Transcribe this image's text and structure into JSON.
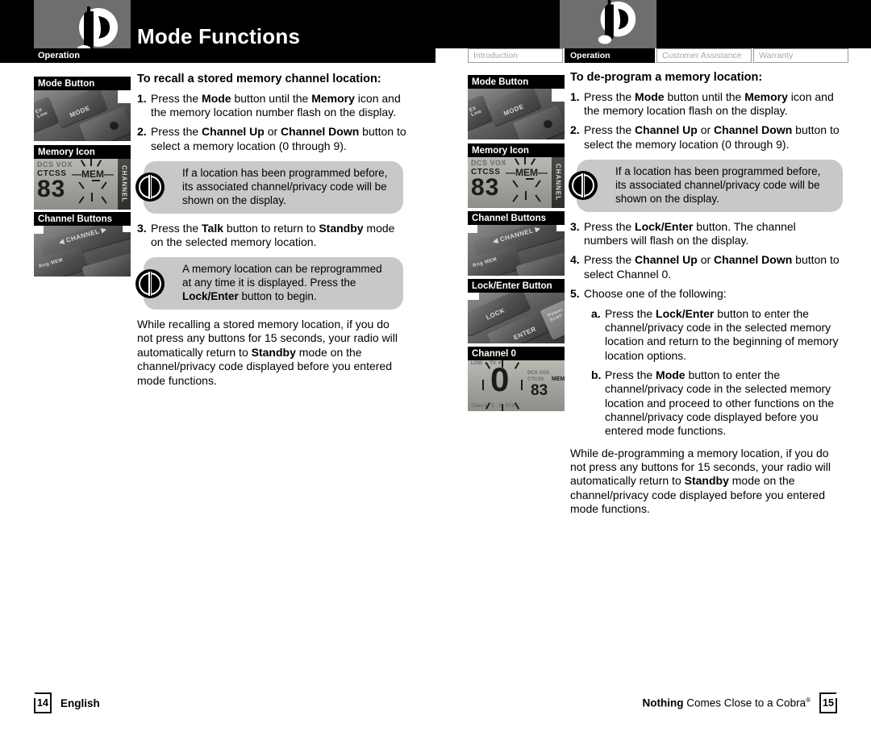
{
  "header": {
    "title": "Mode Functions",
    "logo_icon": "cobra-radio-logo-icon",
    "left_section_chip": "Operation"
  },
  "tabs": [
    {
      "label": "Introduction",
      "active": false
    },
    {
      "label": "Operation",
      "active": true
    },
    {
      "label": "Customer Assistance",
      "active": false
    },
    {
      "label": "Warranty",
      "active": false
    }
  ],
  "left_page": {
    "panels": [
      {
        "label": "Mode Button",
        "type": "keys",
        "caption": "MODE"
      },
      {
        "label": "Memory Icon",
        "type": "lcd",
        "digits": "83",
        "tags": [
          "DCS VOX",
          "CTCSS",
          "MEM"
        ],
        "side": "CHANNEL"
      },
      {
        "label": "Channel Buttons",
        "type": "keys",
        "caption": "CHANNEL"
      }
    ],
    "heading": "To recall a stored memory channel location:",
    "steps": [
      {
        "num": "1.",
        "parts": [
          {
            "t": "Press the ",
            "b": false
          },
          {
            "t": "Mode",
            "b": true
          },
          {
            "t": " button until the ",
            "b": false
          },
          {
            "t": "Memory",
            "b": true
          },
          {
            "t": " icon and the memory location number flash on the display.",
            "b": false
          }
        ]
      },
      {
        "num": "2.",
        "parts": [
          {
            "t": "Press the ",
            "b": false
          },
          {
            "t": "Channel Up",
            "b": true
          },
          {
            "t": " or ",
            "b": false
          },
          {
            "t": "Channel Down",
            "b": true
          },
          {
            "t": " button to select a memory location (0 through 9).",
            "b": false
          }
        ]
      }
    ],
    "note_1": "If a location has been programmed before, its associated channel/privacy code will be shown on the display.",
    "steps_after_note": [
      {
        "num": "3.",
        "parts": [
          {
            "t": "Press the ",
            "b": false
          },
          {
            "t": "Talk",
            "b": true
          },
          {
            "t": " button to return to ",
            "b": false
          },
          {
            "t": "Standby",
            "b": true
          },
          {
            "t": " mode on the selected memory location.",
            "b": false
          }
        ]
      }
    ],
    "note_2": [
      {
        "t": "A memory location can be reprogrammed at any time it is displayed. Press the ",
        "b": false
      },
      {
        "t": "Lock/Enter",
        "b": true
      },
      {
        "t": " button to begin.",
        "b": false
      }
    ],
    "closing": [
      {
        "t": "While recalling a stored memory location, if you do not press any buttons for 15 seconds, your radio will automatically return to ",
        "b": false
      },
      {
        "t": "Standby",
        "b": true
      },
      {
        "t": " mode on the channel/privacy code displayed before you entered mode functions.",
        "b": false
      }
    ],
    "footer": {
      "page": "14",
      "text": "English"
    }
  },
  "right_page": {
    "panels": [
      {
        "label": "Mode Button",
        "type": "keys",
        "caption": "MODE"
      },
      {
        "label": "Memory Icon",
        "type": "lcd",
        "digits": "83",
        "tags": [
          "DCS VOX",
          "CTCSS",
          "MEM"
        ],
        "side": "CHANNEL"
      },
      {
        "label": "Channel Buttons",
        "type": "keys",
        "caption": "CHANNEL"
      },
      {
        "label": "Lock/Enter Button",
        "type": "keys",
        "caption": "LOCK ENTER"
      },
      {
        "label": "Channel 0",
        "type": "lcd",
        "digits": "0",
        "tags": [
          "DCS VOX",
          "CTCSS",
          "MEM"
        ],
        "side": ""
      }
    ],
    "heading": "To de-program a memory location:",
    "steps": [
      {
        "num": "1.",
        "parts": [
          {
            "t": "Press the ",
            "b": false
          },
          {
            "t": "Mode",
            "b": true
          },
          {
            "t": " button until the ",
            "b": false
          },
          {
            "t": "Memory",
            "b": true
          },
          {
            "t": " icon and the memory location flash on the display.",
            "b": false
          }
        ]
      },
      {
        "num": "2.",
        "parts": [
          {
            "t": "Press the ",
            "b": false
          },
          {
            "t": "Channel Up",
            "b": true
          },
          {
            "t": " or ",
            "b": false
          },
          {
            "t": "Channel Down",
            "b": true
          },
          {
            "t": " button to select the memory location (0 through 9).",
            "b": false
          }
        ]
      }
    ],
    "note_1": "If a location has been programmed before, its associated channel/privacy code will be shown on the display.",
    "steps_after_note": [
      {
        "num": "3.",
        "parts": [
          {
            "t": "Press the ",
            "b": false
          },
          {
            "t": "Lock/Enter",
            "b": true
          },
          {
            "t": " button. The channel numbers will flash on the display.",
            "b": false
          }
        ]
      },
      {
        "num": "4.",
        "parts": [
          {
            "t": "Press the ",
            "b": false
          },
          {
            "t": "Channel Up",
            "b": true
          },
          {
            "t": " or ",
            "b": false
          },
          {
            "t": "Channel Down",
            "b": true
          },
          {
            "t": " button to select Channel 0.",
            "b": false
          }
        ]
      },
      {
        "num": "5.",
        "parts": [
          {
            "t": "Choose one of the following:",
            "b": false
          }
        ]
      }
    ],
    "substeps": [
      {
        "num": "a.",
        "parts": [
          {
            "t": "Press the ",
            "b": false
          },
          {
            "t": "Lock/Enter",
            "b": true
          },
          {
            "t": " button to enter the channel/privacy code in the selected memory location and return to the beginning of memory location options.",
            "b": false
          }
        ]
      },
      {
        "num": "b.",
        "parts": [
          {
            "t": "Press the ",
            "b": false
          },
          {
            "t": "Mode",
            "b": true
          },
          {
            "t": " button to enter the channel/privacy code in the selected memory location and proceed to other functions on the channel/privacy code displayed before you entered mode functions.",
            "b": false
          }
        ]
      }
    ],
    "closing": [
      {
        "t": "While de-programming a memory location, if you do not press any buttons for 15 seconds, your radio will automatically return to ",
        "b": false
      },
      {
        "t": "Standby",
        "b": true
      },
      {
        "t": " mode on the channel/privacy code displayed before you entered mode functions.",
        "b": false
      }
    ],
    "footer": {
      "page": "15",
      "tagline_bold": "Nothing",
      "tagline_rest": " Comes Close to a Cobra",
      "reg": "®"
    }
  },
  "colors": {
    "header_black": "#000000",
    "logo_gray": "#6e6e6e",
    "note_gray": "#c8c8c8",
    "tab_inactive_text": "#a8a8a8",
    "page_white": "#ffffff"
  }
}
